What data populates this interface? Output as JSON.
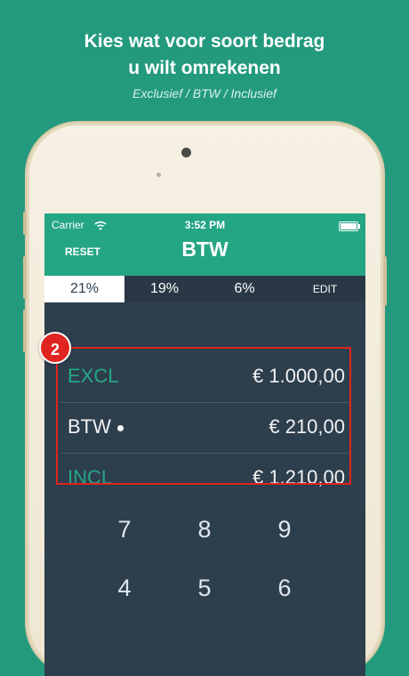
{
  "headline": {
    "line1": "Kies wat voor soort bedrag",
    "line2": "u wilt omrekenen",
    "subtitle": "Exclusief / BTW / Inclusief"
  },
  "status_bar": {
    "carrier": "Carrier",
    "time": "3:52 PM"
  },
  "app": {
    "title": "BTW",
    "reset_label": "RESET",
    "tabs": [
      {
        "label": "21%",
        "active": true
      },
      {
        "label": "19%",
        "active": false
      },
      {
        "label": "6%",
        "active": false
      },
      {
        "label": "EDIT",
        "active": false
      }
    ],
    "rows": [
      {
        "label": "EXCL",
        "value": "€ 1.000,00"
      },
      {
        "label": "BTW",
        "value": "€ 210,00"
      },
      {
        "label": "INCL",
        "value": "€ 1.210,00"
      }
    ],
    "badge": "2",
    "keypad": [
      "7",
      "8",
      "9",
      "4",
      "5",
      "6"
    ]
  },
  "colors": {
    "background": "#239a7e",
    "accent": "#24a584",
    "screen": "#2d3e4d",
    "highlight": "#e0241f"
  }
}
